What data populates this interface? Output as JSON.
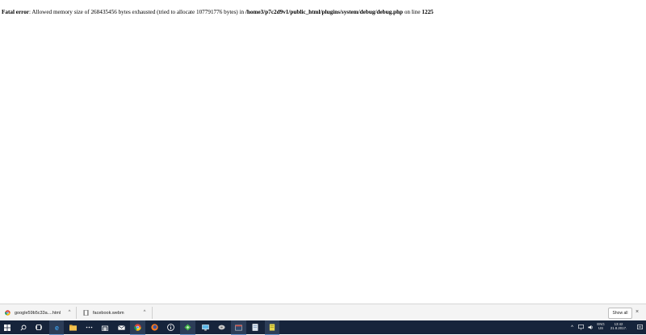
{
  "error": {
    "label": "Fatal error",
    "message": ": Allowed memory size of 268435456 bytes exhausted (tried to allocate 107791776 bytes) in ",
    "path": "/home3/p7c2d9v1/public_html/plugins/system/debug/debug.php",
    "line_text": " on line ",
    "line_number": "1225"
  },
  "downloads": {
    "items": [
      {
        "name": "google59b5c33a....html",
        "icon": "chrome-html-file-icon"
      },
      {
        "name": "facebook.webm",
        "icon": "video-file-icon"
      }
    ],
    "show_all": "Show all",
    "close": "×"
  },
  "taskbar": {
    "apps": [
      "windows-start-icon",
      "search-icon",
      "task-view-icon",
      "edge-icon",
      "file-explorer-icon",
      "more-dots-icon",
      "store-icon",
      "mail-icon",
      "chrome-icon",
      "firefox-icon",
      "info-icon",
      "app-green-icon",
      "app-monitor-icon",
      "app-disk-icon",
      "app-window-icon",
      "app-sheet-icon",
      "app-notes-icon"
    ],
    "tray": {
      "language_top": "ENG",
      "language_bottom": "US",
      "time": "13:42",
      "date": "21.8.2017."
    }
  },
  "colors": {
    "taskbar_bg": "#16243b",
    "shelf_bg": "#f4f4f4"
  }
}
